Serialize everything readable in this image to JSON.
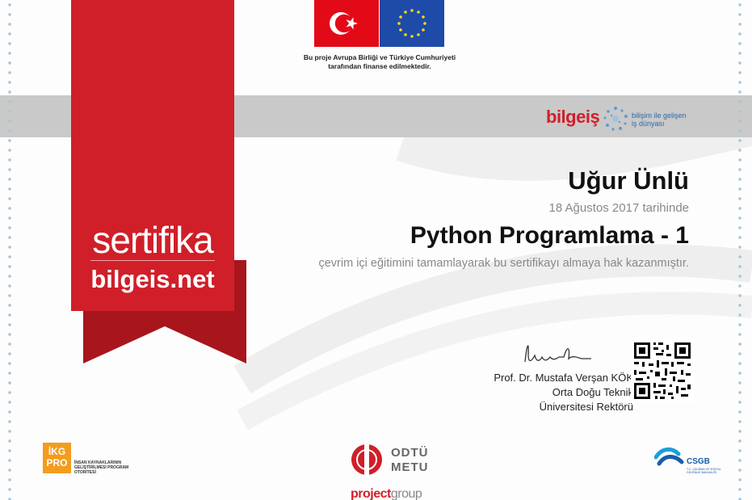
{
  "funding": {
    "line1": "Bu proje Avrupa Birliği ve Türkiye Cumhuriyeti",
    "line2": "tarafından finanse edilmektedir."
  },
  "ribbon": {
    "title": "sertifika",
    "site": "bilgeis.net"
  },
  "bilgeis_logo": {
    "word": "bilgeiş",
    "tag_line1": "bilişim ile gelişen",
    "tag_line2": "iş dünyası"
  },
  "certificate": {
    "recipient": "Uğur Ünlü",
    "date_text": "18 Ağustos 2017 tarihinde",
    "course": "Python Programlama - 1",
    "description": "çevrim içi eğitimini tamamlayarak bu sertifikayı almaya hak kazanmıştır."
  },
  "signatory": {
    "name": "Prof. Dr. Mustafa Verşan KÖK",
    "line2": "Orta Doğu Teknik",
    "line3": "Üniversitesi Rektörü"
  },
  "footer": {
    "ikg_badge_line1": "İKG",
    "ikg_badge_line2": "PRO",
    "ikg_text": "İNSAN KAYNAKLARININ GELİŞTİRİLMESİ PROGRAM OTORİTESİ",
    "metu_line1": "ODTÜ",
    "metu_line2": "METU",
    "project_word1": "project",
    "project_word2": "group",
    "csgb": "CSGB",
    "csgb_sub": "T.C. ÇALIŞMA VE SOSYAL GÜVENLİK BAKANLIĞI"
  },
  "colors": {
    "brand_red": "#d01f28",
    "band_grey": "#c9c9c9",
    "eu_blue": "#1f4ba8",
    "tr_red": "#e30a17"
  }
}
